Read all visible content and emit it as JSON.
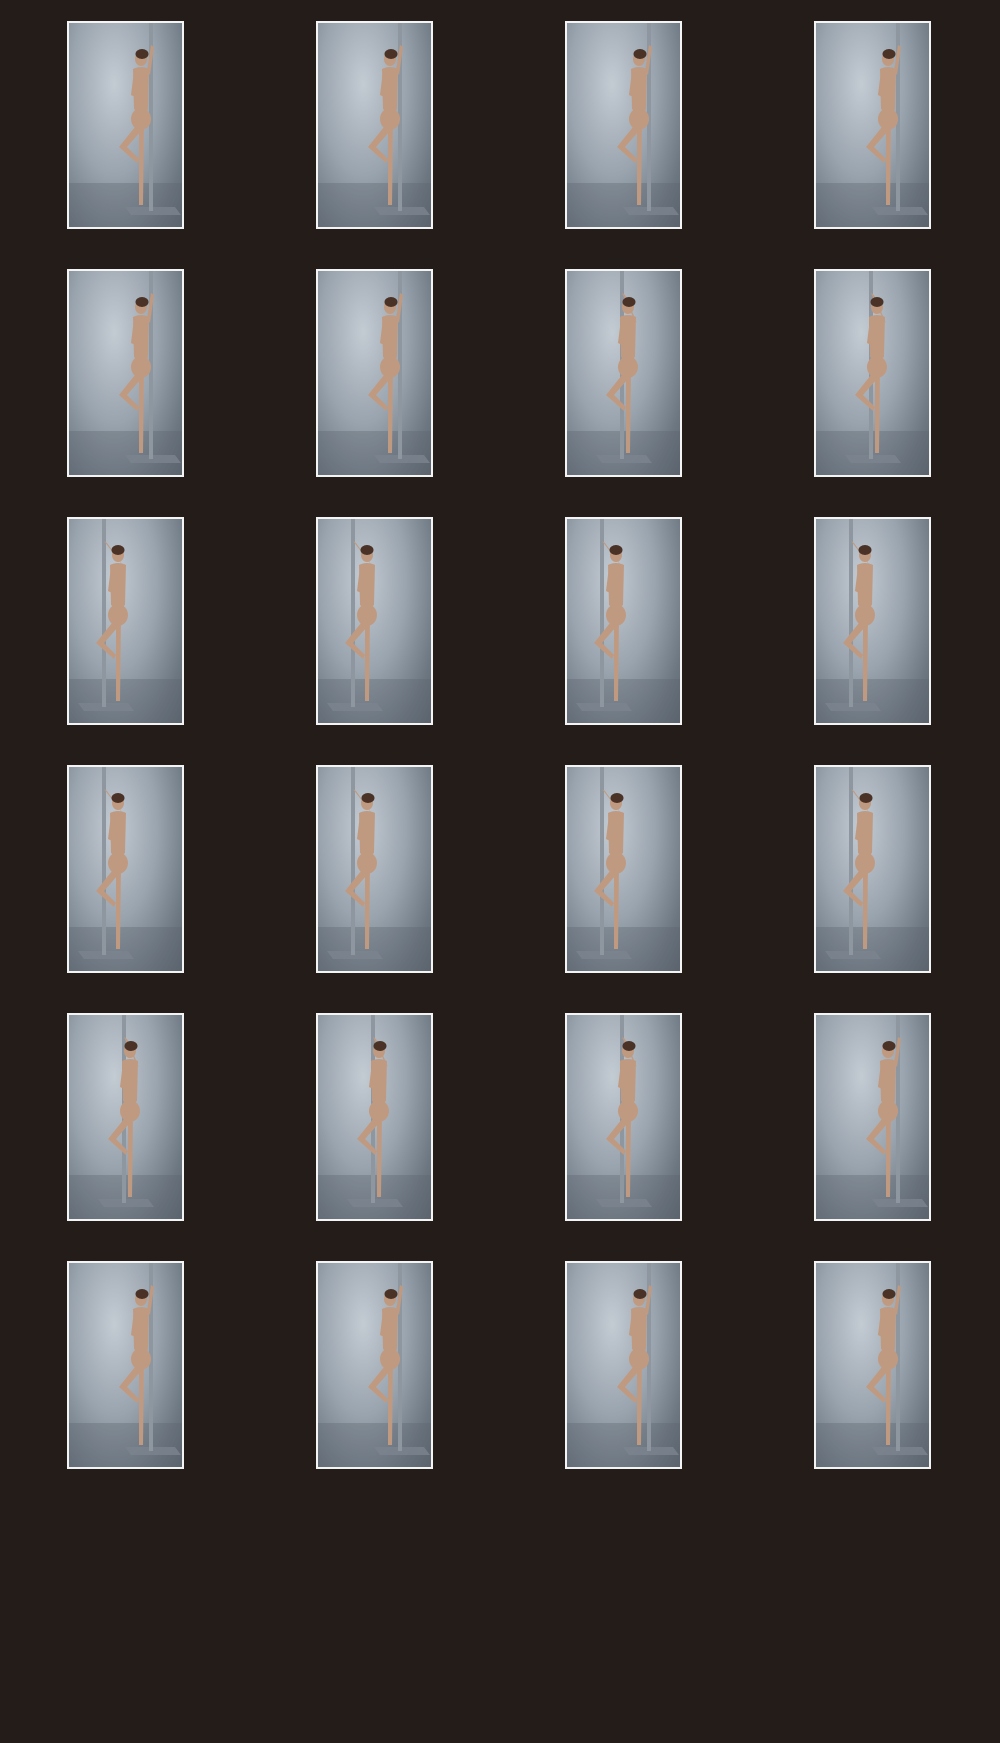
{
  "colors": {
    "page_background": "#241c18",
    "thumbnail_border": "#f4f4f4",
    "backdrop_light": "#c3cbd3",
    "backdrop_dark": "#5b646e",
    "pole": "#8e979f",
    "figure_skin": "#c09a80",
    "figure_hair": "#4a3226"
  },
  "thumbnails": [
    {
      "pole": "right",
      "facing": "front"
    },
    {
      "pole": "right",
      "facing": "front"
    },
    {
      "pole": "right",
      "facing": "front"
    },
    {
      "pole": "right",
      "facing": "three-quarter"
    },
    {
      "pole": "right",
      "facing": "side"
    },
    {
      "pole": "right",
      "facing": "side"
    },
    {
      "pole": "center",
      "facing": "side"
    },
    {
      "pole": "center",
      "facing": "back"
    },
    {
      "pole": "left",
      "facing": "back"
    },
    {
      "pole": "left",
      "facing": "back"
    },
    {
      "pole": "left",
      "facing": "back"
    },
    {
      "pole": "left",
      "facing": "back"
    },
    {
      "pole": "left",
      "facing": "back"
    },
    {
      "pole": "left",
      "facing": "three-quarter"
    },
    {
      "pole": "left",
      "facing": "side"
    },
    {
      "pole": "left",
      "facing": "side"
    },
    {
      "pole": "center",
      "facing": "side"
    },
    {
      "pole": "center",
      "facing": "side"
    },
    {
      "pole": "center",
      "facing": "three-quarter"
    },
    {
      "pole": "right",
      "facing": "front"
    },
    {
      "pole": "right",
      "facing": "front"
    },
    {
      "pole": "right",
      "facing": "front"
    },
    {
      "pole": "right",
      "facing": "front"
    },
    {
      "pole": "right",
      "facing": "front"
    }
  ]
}
